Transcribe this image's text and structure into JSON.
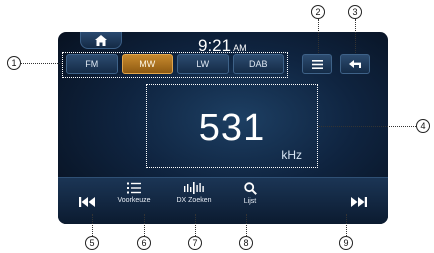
{
  "status": {
    "time": "9:21",
    "ampm": "AM"
  },
  "bands": [
    {
      "label": "FM",
      "active": false
    },
    {
      "label": "MW",
      "active": true
    },
    {
      "label": "LW",
      "active": false
    },
    {
      "label": "DAB",
      "active": false
    }
  ],
  "tuner": {
    "frequency": "531",
    "unit": "kHz"
  },
  "bottom_bar": {
    "presets_label": "Voorkeuze",
    "dx_search_label": "DX Zoeken",
    "list_label": "Lijst"
  },
  "callouts": [
    "1",
    "2",
    "3",
    "4",
    "5",
    "6",
    "7",
    "8",
    "9"
  ],
  "colors": {
    "active_band": "#c88a2e",
    "screen_bg": "#0f2440"
  },
  "icons": [
    "home-icon",
    "menu-icon",
    "back-arrow-icon",
    "skip-previous-icon",
    "preset-list-icon",
    "dx-search-icon",
    "search-icon",
    "skip-next-icon"
  ]
}
